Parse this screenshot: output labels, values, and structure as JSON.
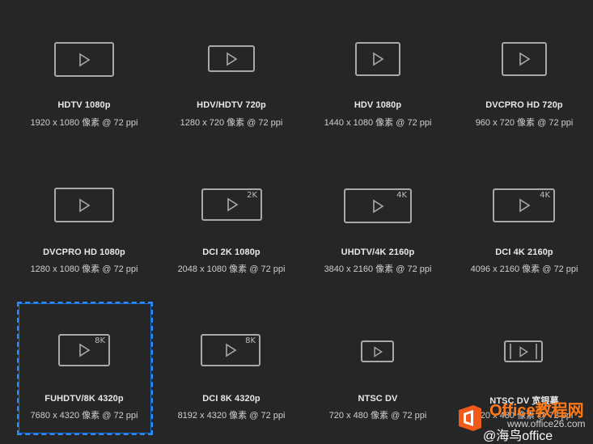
{
  "presets": [
    {
      "title": "HDTV 1080p",
      "subtitle": "1920 x 1080 像素 @ 72 ppi",
      "badge": "",
      "icon": "video-wide-icon"
    },
    {
      "title": "HDV/HDTV 720p",
      "subtitle": "1280 x 720 像素 @ 72 ppi",
      "badge": "",
      "icon": "video-wide-icon"
    },
    {
      "title": "HDV 1080p",
      "subtitle": "1440 x 1080 像素 @ 72 ppi",
      "badge": "",
      "icon": "video-wide-icon"
    },
    {
      "title": "DVCPRO HD 720p",
      "subtitle": "960 x 720 像素 @ 72 ppi",
      "badge": "",
      "icon": "video-wide-icon"
    },
    {
      "title": "DVCPRO HD 1080p",
      "subtitle": "1280 x 1080 像素 @ 72 ppi",
      "badge": "",
      "icon": "video-wide-icon"
    },
    {
      "title": "DCI 2K 1080p",
      "subtitle": "2048 x 1080 像素 @ 72 ppi",
      "badge": "2K",
      "icon": "video-2k-icon"
    },
    {
      "title": "UHDTV/4K 2160p",
      "subtitle": "3840 x 2160 像素 @ 72 ppi",
      "badge": "4K",
      "icon": "video-4k-icon"
    },
    {
      "title": "DCI 4K 2160p",
      "subtitle": "4096 x 2160 像素 @ 72 ppi",
      "badge": "4K",
      "icon": "video-4k-icon"
    },
    {
      "title": "FUHDTV/8K 4320p",
      "subtitle": "7680 x 4320 像素 @ 72 ppi",
      "badge": "8K",
      "icon": "video-8k-icon"
    },
    {
      "title": "DCI 8K 4320p",
      "subtitle": "8192 x 4320 像素 @ 72 ppi",
      "badge": "8K",
      "icon": "video-8k-icon"
    },
    {
      "title": "NTSC DV",
      "subtitle": "720 x 480 像素 @ 72 ppi",
      "badge": "",
      "icon": "video-small-icon"
    },
    {
      "title": "NTSC DV 宽银幕",
      "subtitle": "720 x 480 像素 @ 72 ppi",
      "badge": "",
      "icon": "video-widescreen-icon"
    }
  ],
  "selected_index": 8,
  "watermark": {
    "brand": "Office教程网",
    "url": "www.office26.com",
    "handle": "@海鸟office"
  },
  "colors": {
    "background": "#262626",
    "icon_stroke": "#a9a9a9",
    "selection": "#2a8cff",
    "watermark_orange": "#ff7a16"
  }
}
